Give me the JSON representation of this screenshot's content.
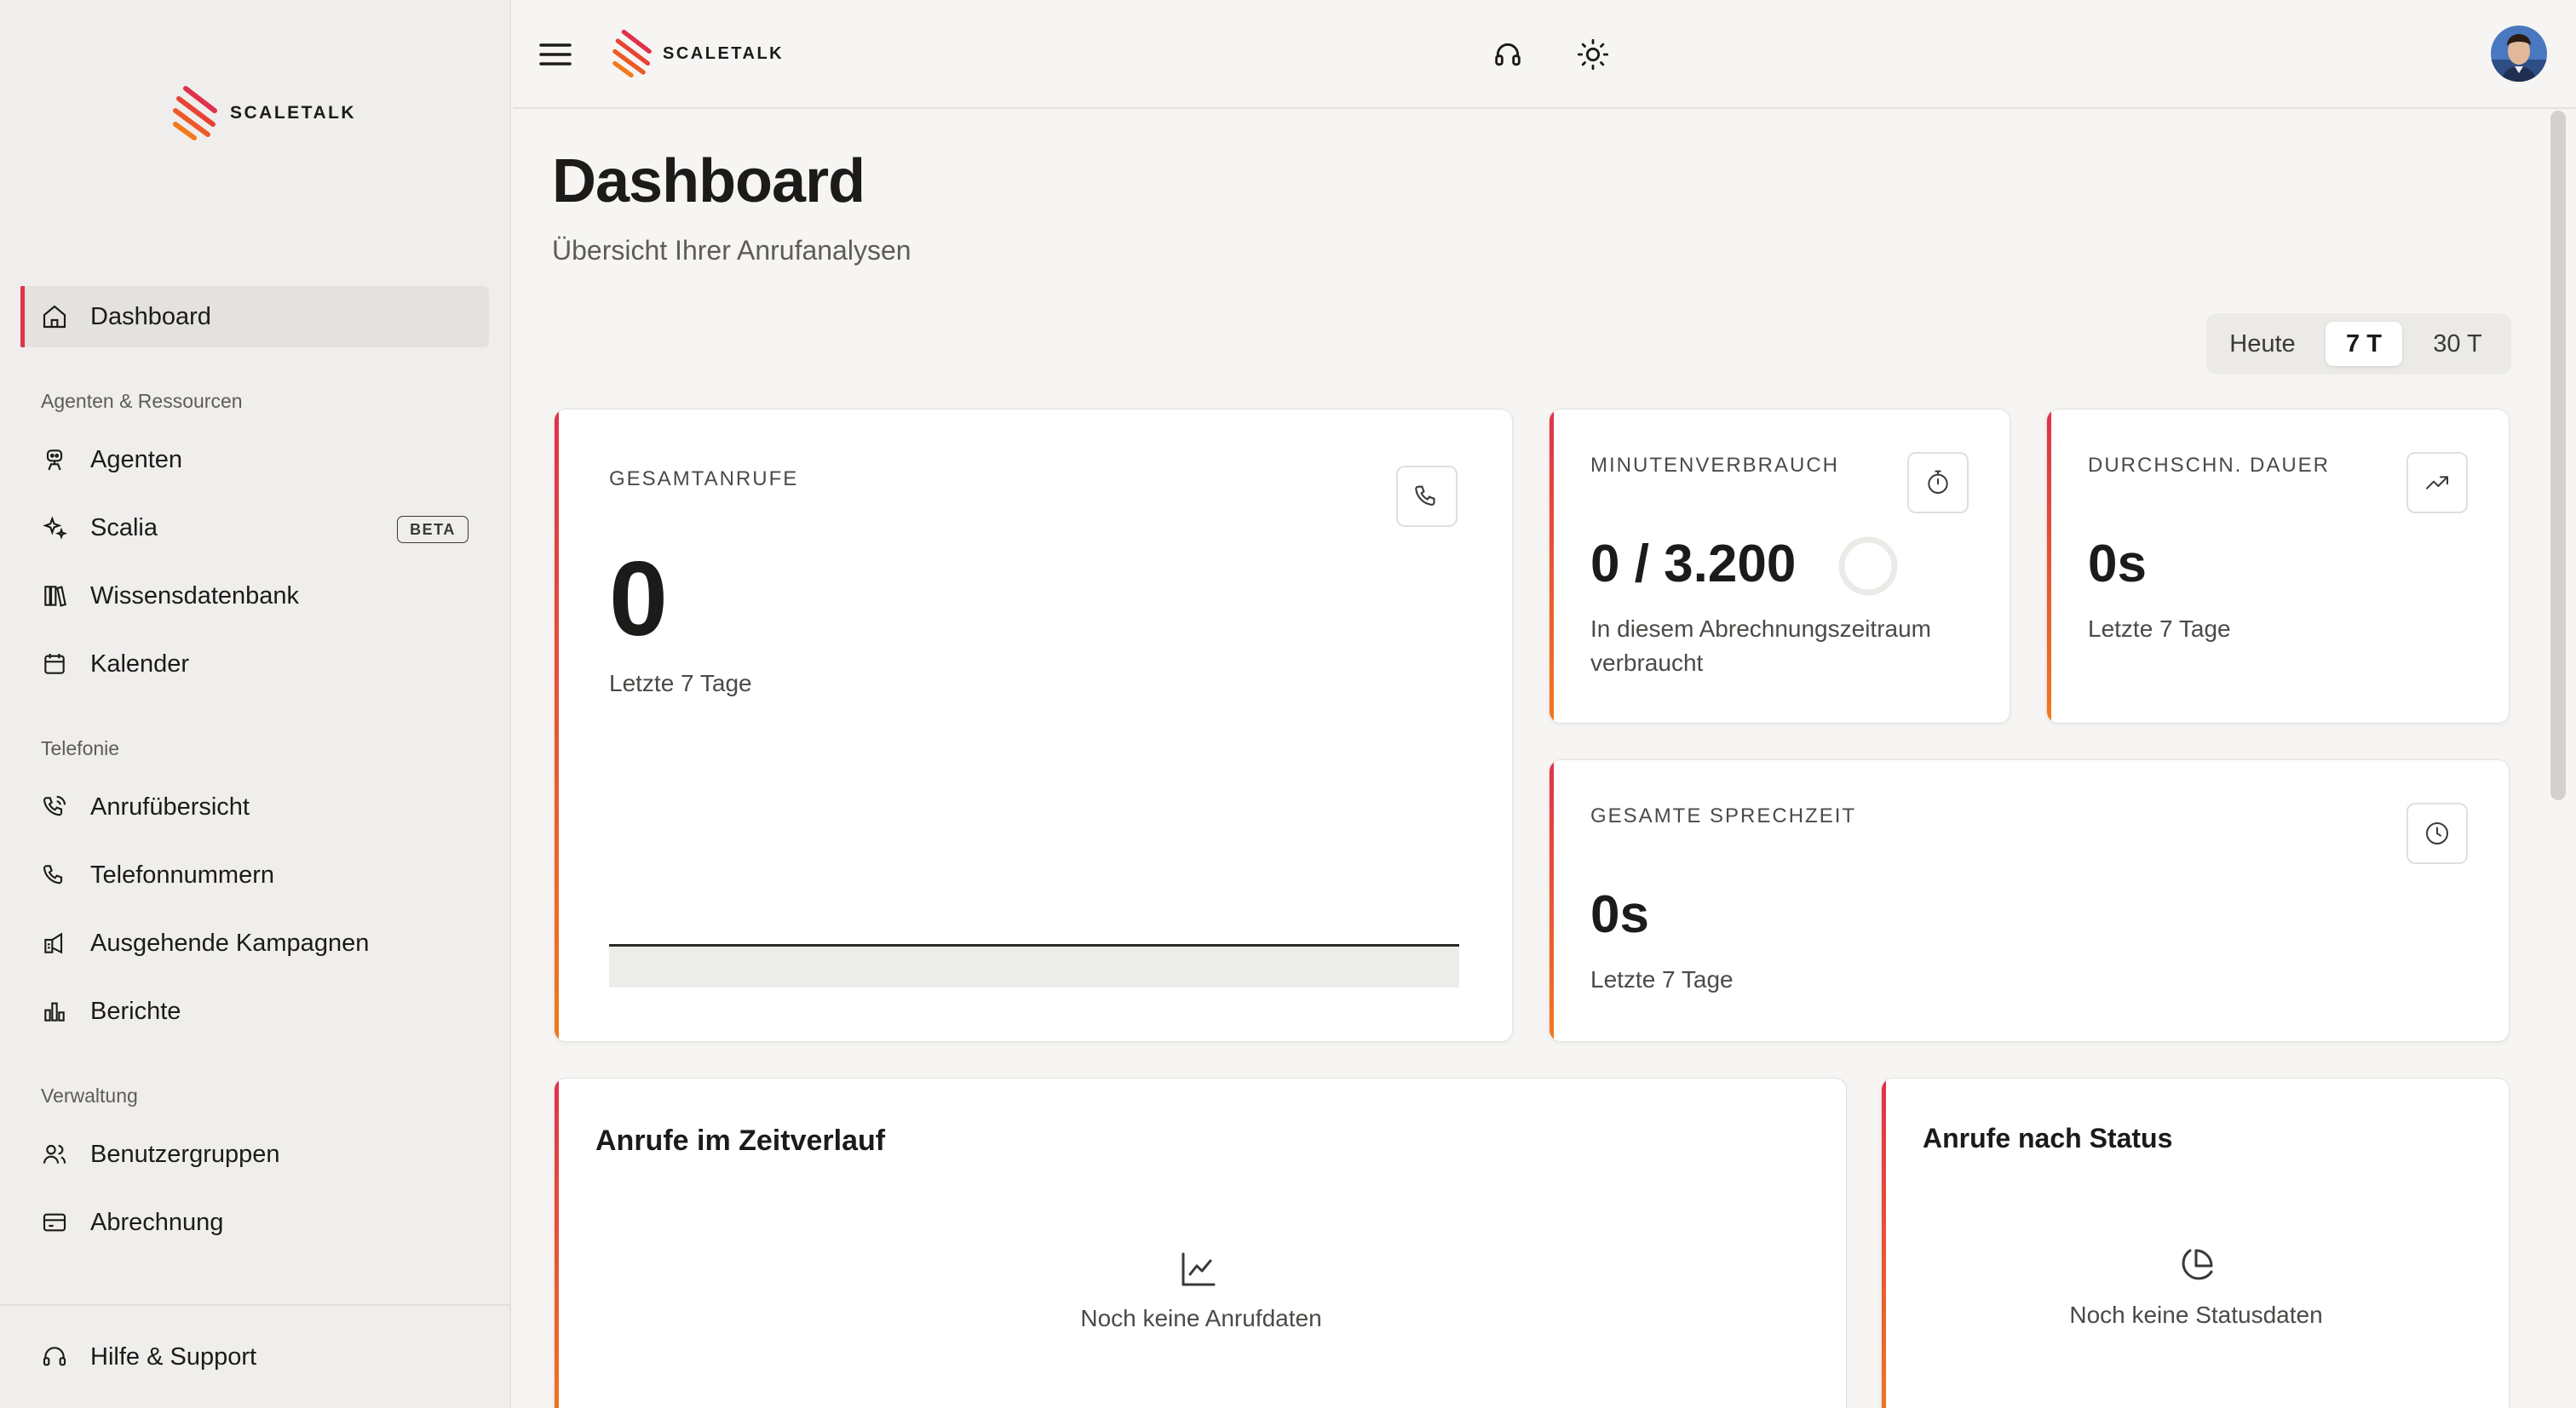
{
  "app": {
    "brand": "SCALETALK",
    "brand_color": "#e0314b",
    "accent_gradient": [
      "#e0314b",
      "#f07a1d"
    ]
  },
  "sidebar": {
    "items": [
      {
        "label": "Dashboard",
        "icon": "home-icon",
        "active": true
      },
      {
        "label": "Agenten",
        "icon": "bot-icon"
      },
      {
        "label": "Scalia",
        "icon": "sparkles-icon",
        "badge": "BETA"
      },
      {
        "label": "Wissensdatenbank",
        "icon": "library-icon"
      },
      {
        "label": "Kalender",
        "icon": "calendar-icon"
      },
      {
        "label": "Anrufübersicht",
        "icon": "phone-call-icon"
      },
      {
        "label": "Telefonnummern",
        "icon": "phone-icon"
      },
      {
        "label": "Ausgehende Kampagnen",
        "icon": "megaphone-icon"
      },
      {
        "label": "Berichte",
        "icon": "bar-chart-icon"
      },
      {
        "label": "Benutzergruppen",
        "icon": "users-icon"
      },
      {
        "label": "Abrechnung",
        "icon": "credit-card-icon"
      },
      {
        "label": "Hilfe & Support",
        "icon": "headset-icon"
      }
    ],
    "sections": {
      "agents": "Agenten & Ressourcen",
      "telephony": "Telefonie",
      "admin": "Verwaltung"
    }
  },
  "header": {
    "icons": [
      "menu-icon",
      "headset-icon",
      "sun-icon",
      "avatar"
    ]
  },
  "page": {
    "title": "Dashboard",
    "subtitle": "Übersicht Ihrer Anrufanalysen"
  },
  "range": {
    "options": [
      "Heute",
      "7 T",
      "30 T"
    ],
    "selected": "7 T"
  },
  "stats": {
    "total_calls": {
      "label": "GESAMTANRUFE",
      "value": "0",
      "sub": "Letzte 7 Tage",
      "icon": "phone-icon"
    },
    "minutes": {
      "label": "MINUTENVERBRAUCH",
      "value": "0 / 3.200",
      "sub": "In diesem Abrechnungszeitraum verbraucht",
      "used_fraction": 0,
      "icon": "timer-icon"
    },
    "avg_duration": {
      "label": "DURCHSCHN. DAUER",
      "value": "0s",
      "sub": "Letzte 7 Tage",
      "icon": "trending-up-icon"
    },
    "talk_time": {
      "label": "GESAMTE SPRECHZEIT",
      "value": "0s",
      "sub": "Letzte 7 Tage",
      "icon": "clock-icon"
    }
  },
  "charts": {
    "timeline": {
      "title": "Anrufe im Zeitverlauf",
      "empty": "Noch keine Anrufdaten",
      "icon": "line-chart-icon"
    },
    "status": {
      "title": "Anrufe nach Status",
      "empty": "Noch keine Statusdaten",
      "icon": "pie-chart-icon"
    }
  }
}
